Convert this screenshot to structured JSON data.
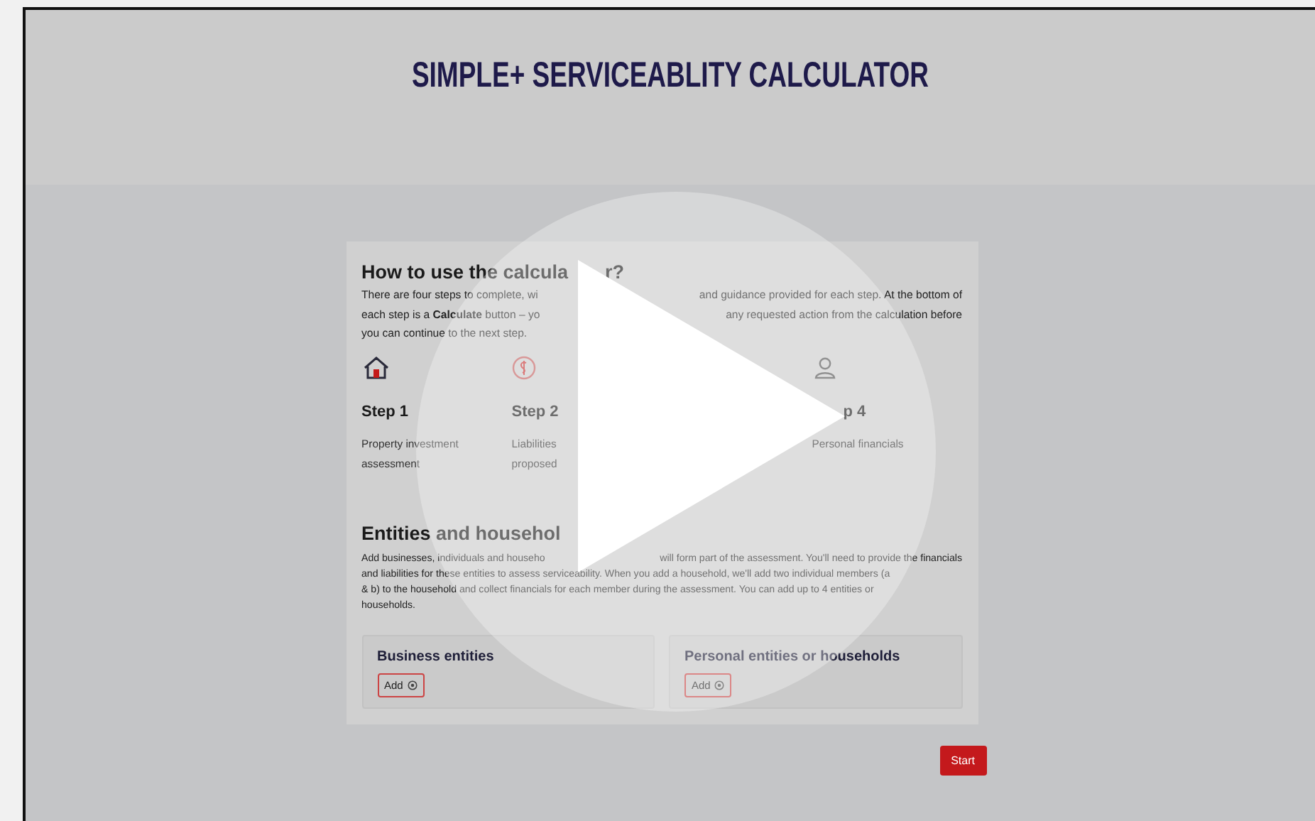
{
  "header": {
    "title": "SIMPLE+ SERVICEABLITY CALCULATOR"
  },
  "intro": {
    "heading_left": "How to use the calcula",
    "heading_right": "r?",
    "lines": [
      {
        "left": "There are four steps to complete, wi",
        "right": "and guidance provided for each step. At the bottom of"
      },
      {
        "left": "each step is a **Calculate** button – yo",
        "right": "any requested action from the calculation before"
      },
      {
        "left": "you can continue to the next step."
      }
    ]
  },
  "steps": [
    {
      "kind": "house",
      "label": "Step 1",
      "description": [
        "Property investment",
        "assessment"
      ]
    },
    {
      "kind": "money",
      "label": "Step 2",
      "description": [
        "Liabilities",
        "proposed"
      ]
    },
    {
      "kind": "hidden"
    },
    {
      "kind": "person",
      "label": "p 4",
      "description": [
        "Personal financials"
      ]
    }
  ],
  "entities": {
    "heading": "Entities and househol",
    "lines": [
      {
        "left": "Add businesses, individuals and househo",
        "right": "will form part of the assessment. You'll need to provide the financials"
      },
      {
        "left": "and liabilities for these entities to assess serviceability. When you add a household, we'll add two individual members (a"
      },
      {
        "left": "& b) to the household and collect financials for each member during the assessment. You can add up to 4 entities or"
      },
      {
        "left": "households."
      }
    ],
    "boxes": [
      {
        "title": "Business entities",
        "button": "Add"
      },
      {
        "title": "Personal entities or households",
        "button": "Add"
      }
    ]
  },
  "start_button": "Start"
}
